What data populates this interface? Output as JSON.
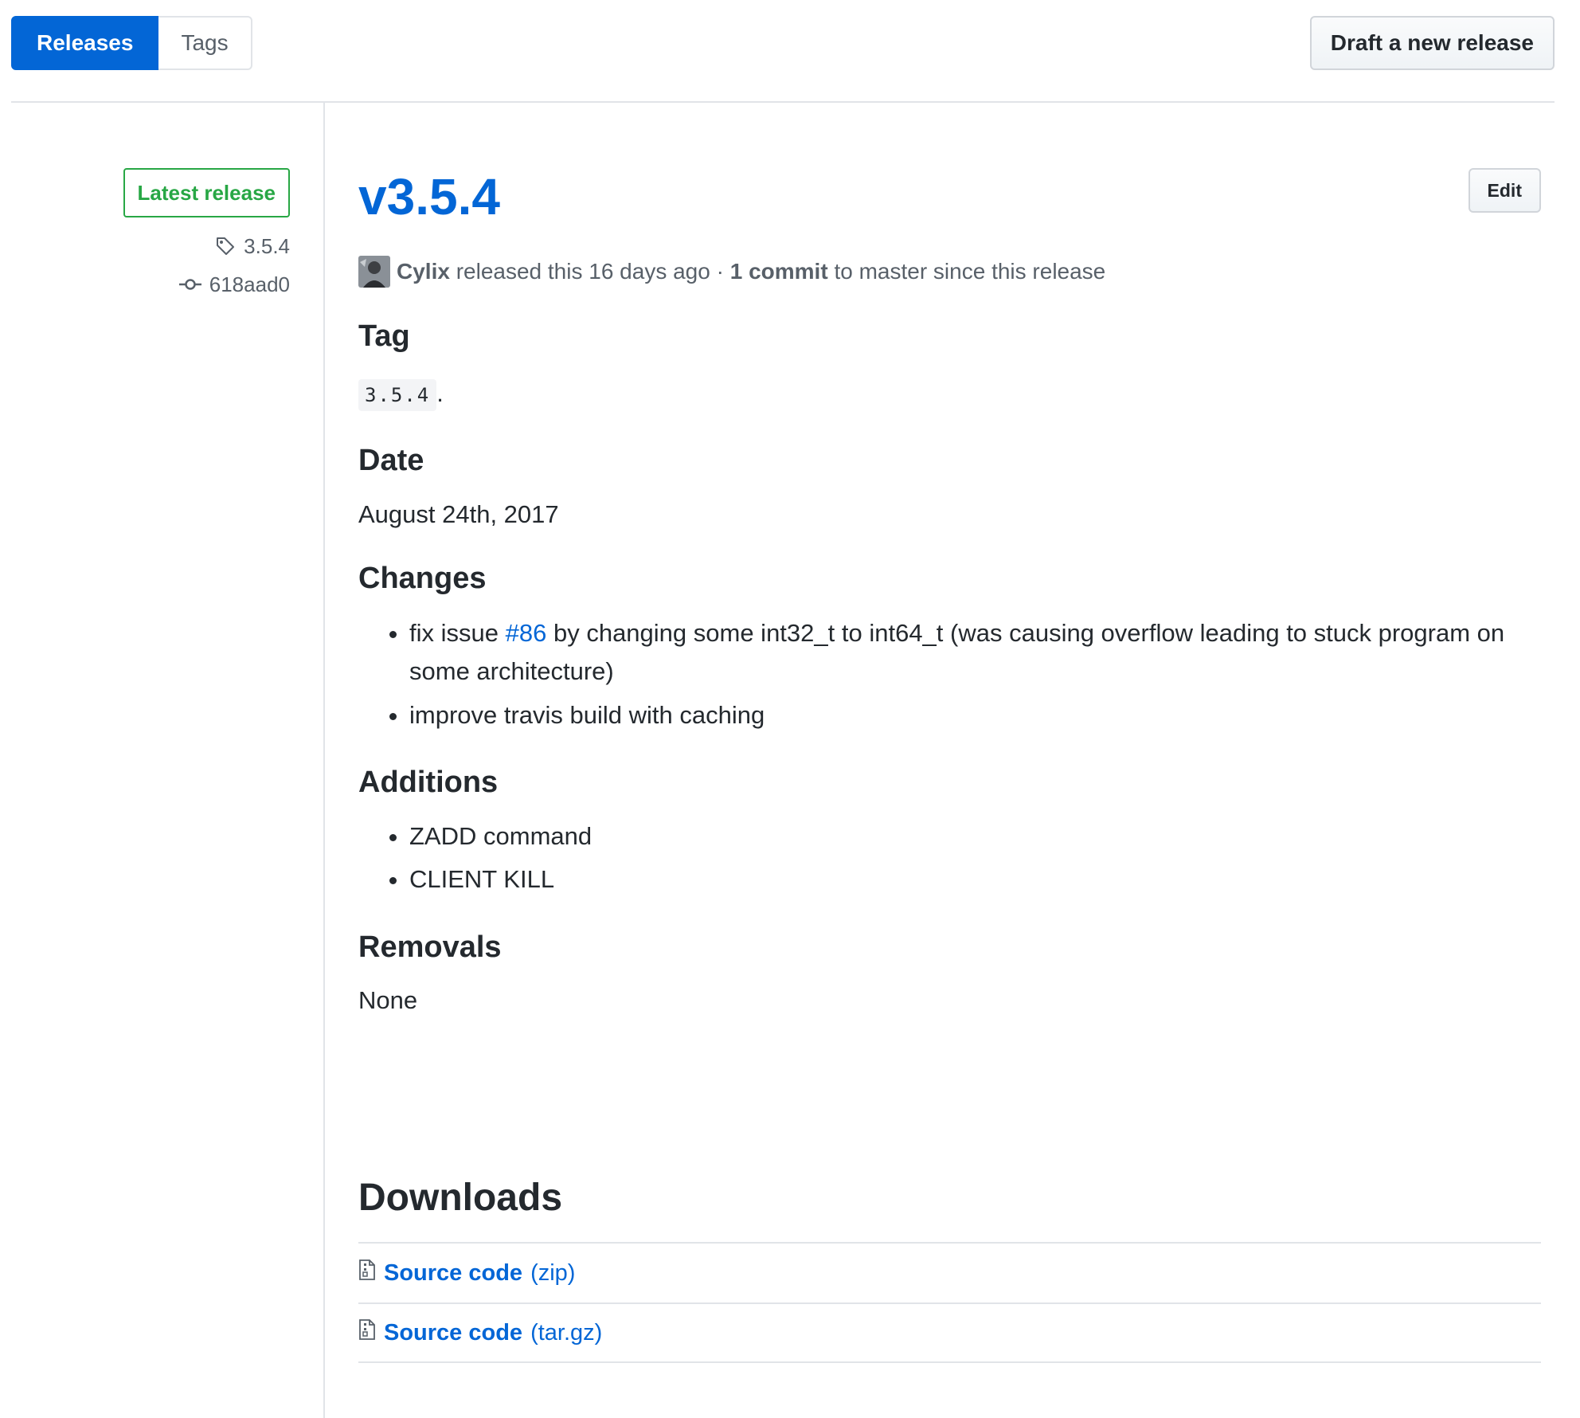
{
  "subnav": {
    "releases": "Releases",
    "tags": "Tags",
    "draft_button": "Draft a new release"
  },
  "sidebar": {
    "latest_label": "Latest release",
    "tag": "3.5.4",
    "commit": "618aad0"
  },
  "release": {
    "edit_button": "Edit",
    "title": "v3.5.4",
    "author": "Cylix",
    "released_text": "released this 16 days ago",
    "separator": "·",
    "commit_count": "1 commit",
    "commit_suffix": "to master since this release",
    "sections": {
      "tag": {
        "heading": "Tag",
        "code": "3.5.4",
        "suffix": "."
      },
      "date": {
        "heading": "Date",
        "text": "August 24th, 2017"
      },
      "changes": {
        "heading": "Changes",
        "item1_before": "fix issue",
        "item1_link": "#86",
        "item1_after": "by changing some int32_t to int64_t (was causing overflow leading to stuck program on some architecture)",
        "item2": "improve travis build with caching"
      },
      "additions": {
        "heading": "Additions",
        "items": [
          "ZADD command",
          "CLIENT KILL"
        ]
      },
      "removals": {
        "heading": "Removals",
        "text": "None"
      }
    },
    "downloads": {
      "heading": "Downloads",
      "items": [
        {
          "label": "Source code",
          "ext": "(zip)"
        },
        {
          "label": "Source code",
          "ext": "(tar.gz)"
        }
      ]
    }
  }
}
